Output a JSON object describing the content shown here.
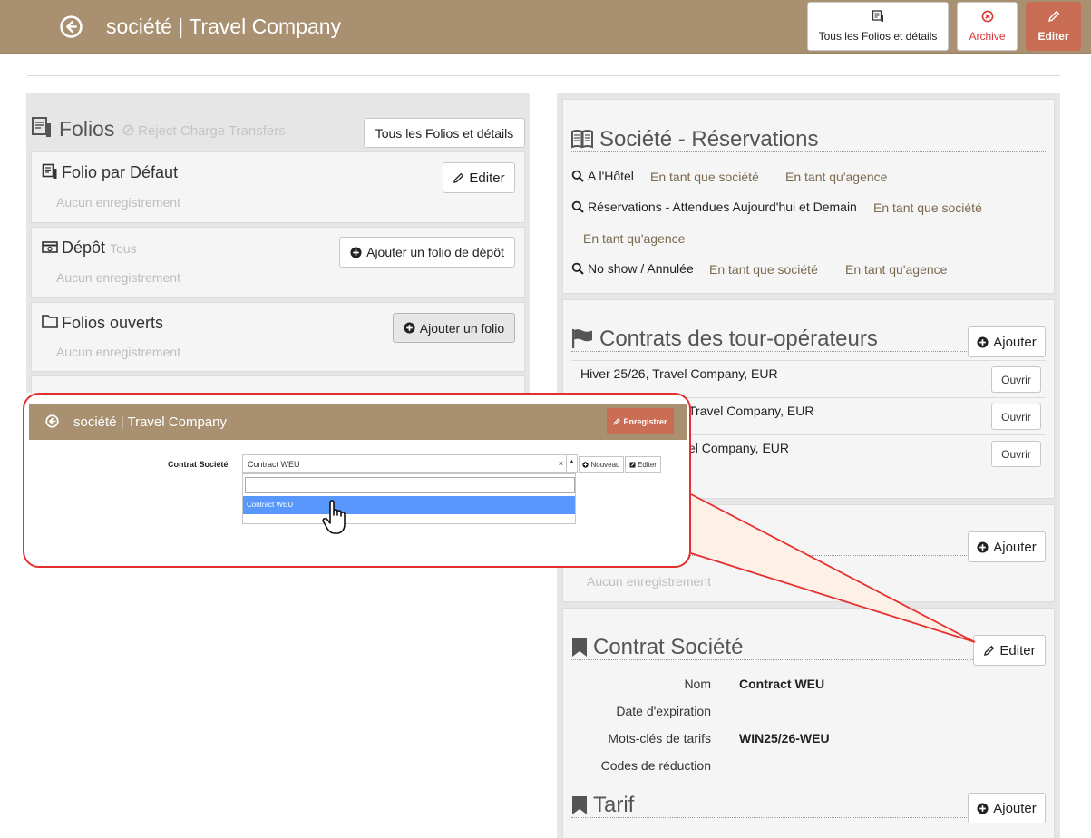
{
  "header": {
    "title": "société | Travel Company",
    "all_folios_label": "Tous les Folios et détails",
    "archive_label": "Archive",
    "edit_label": "Editer"
  },
  "folios": {
    "title": "Folios",
    "reject_label": "Reject Charge Transfers",
    "all_folios_button": "Tous les Folios et détails",
    "default_folio": {
      "title": "Folio par Défaut",
      "edit_label": "Editer",
      "empty": "Aucun enregistrement"
    },
    "deposit": {
      "title": "Dépôt",
      "subtitle": "Tous",
      "add_label": "Ajouter un folio de dépôt",
      "empty": "Aucun enregistrement"
    },
    "open_folios": {
      "title": "Folios ouverts",
      "add_label": "Ajouter un folio",
      "empty": "Aucun enregistrement"
    }
  },
  "reservations": {
    "title": "Société - Réservations",
    "rows": [
      {
        "label": "A l'Hôtel",
        "as_company": "En tant que société",
        "as_agency": "En tant qu'agence"
      },
      {
        "label": "Réservations - Attendues Aujourd'hui et Demain",
        "as_company": "En tant que société",
        "as_agency": "En tant qu'agence"
      },
      {
        "label": "No show / Annulée",
        "as_company": "En tant que société",
        "as_agency": "En tant qu'agence"
      }
    ]
  },
  "contracts": {
    "title": "Contrats des tour-opérateurs",
    "add_label": "Ajouter",
    "items": [
      {
        "text": "Hiver 25/26, Travel Company, EUR",
        "open_label": "Ouvrir"
      },
      {
        "text": "Travel Company, EUR",
        "open_label": "Ouvrir"
      },
      {
        "text": "el Company, EUR",
        "open_label": "Ouvrir"
      }
    ]
  },
  "hidden_section": {
    "add_label": "Ajouter",
    "empty": "Aucun enregistrement"
  },
  "company_contract": {
    "title": "Contrat Société",
    "edit_label": "Editer",
    "fields": [
      {
        "label": "Nom",
        "value": "Contract WEU"
      },
      {
        "label": "Date d'expiration",
        "value": ""
      },
      {
        "label": "Mots-clés de tarifs",
        "value": "WIN25/26-WEU"
      },
      {
        "label": "Codes de réduction",
        "value": ""
      }
    ]
  },
  "tarif": {
    "title": "Tarif",
    "add_label": "Ajouter"
  },
  "callout": {
    "title": "société | Travel Company",
    "save_label": "Enregistrer",
    "field_label": "Contrat Société",
    "selected_value": "Contract WEU",
    "clear_symbol": "×",
    "new_label": "Nouveau",
    "edit_label": "Editer",
    "option": "Contract WEU"
  },
  "colors": {
    "header": "#a89070",
    "accent": "#c96d54",
    "archive": "#d93535",
    "highlight": "#e53030",
    "option": "#5897fb"
  }
}
